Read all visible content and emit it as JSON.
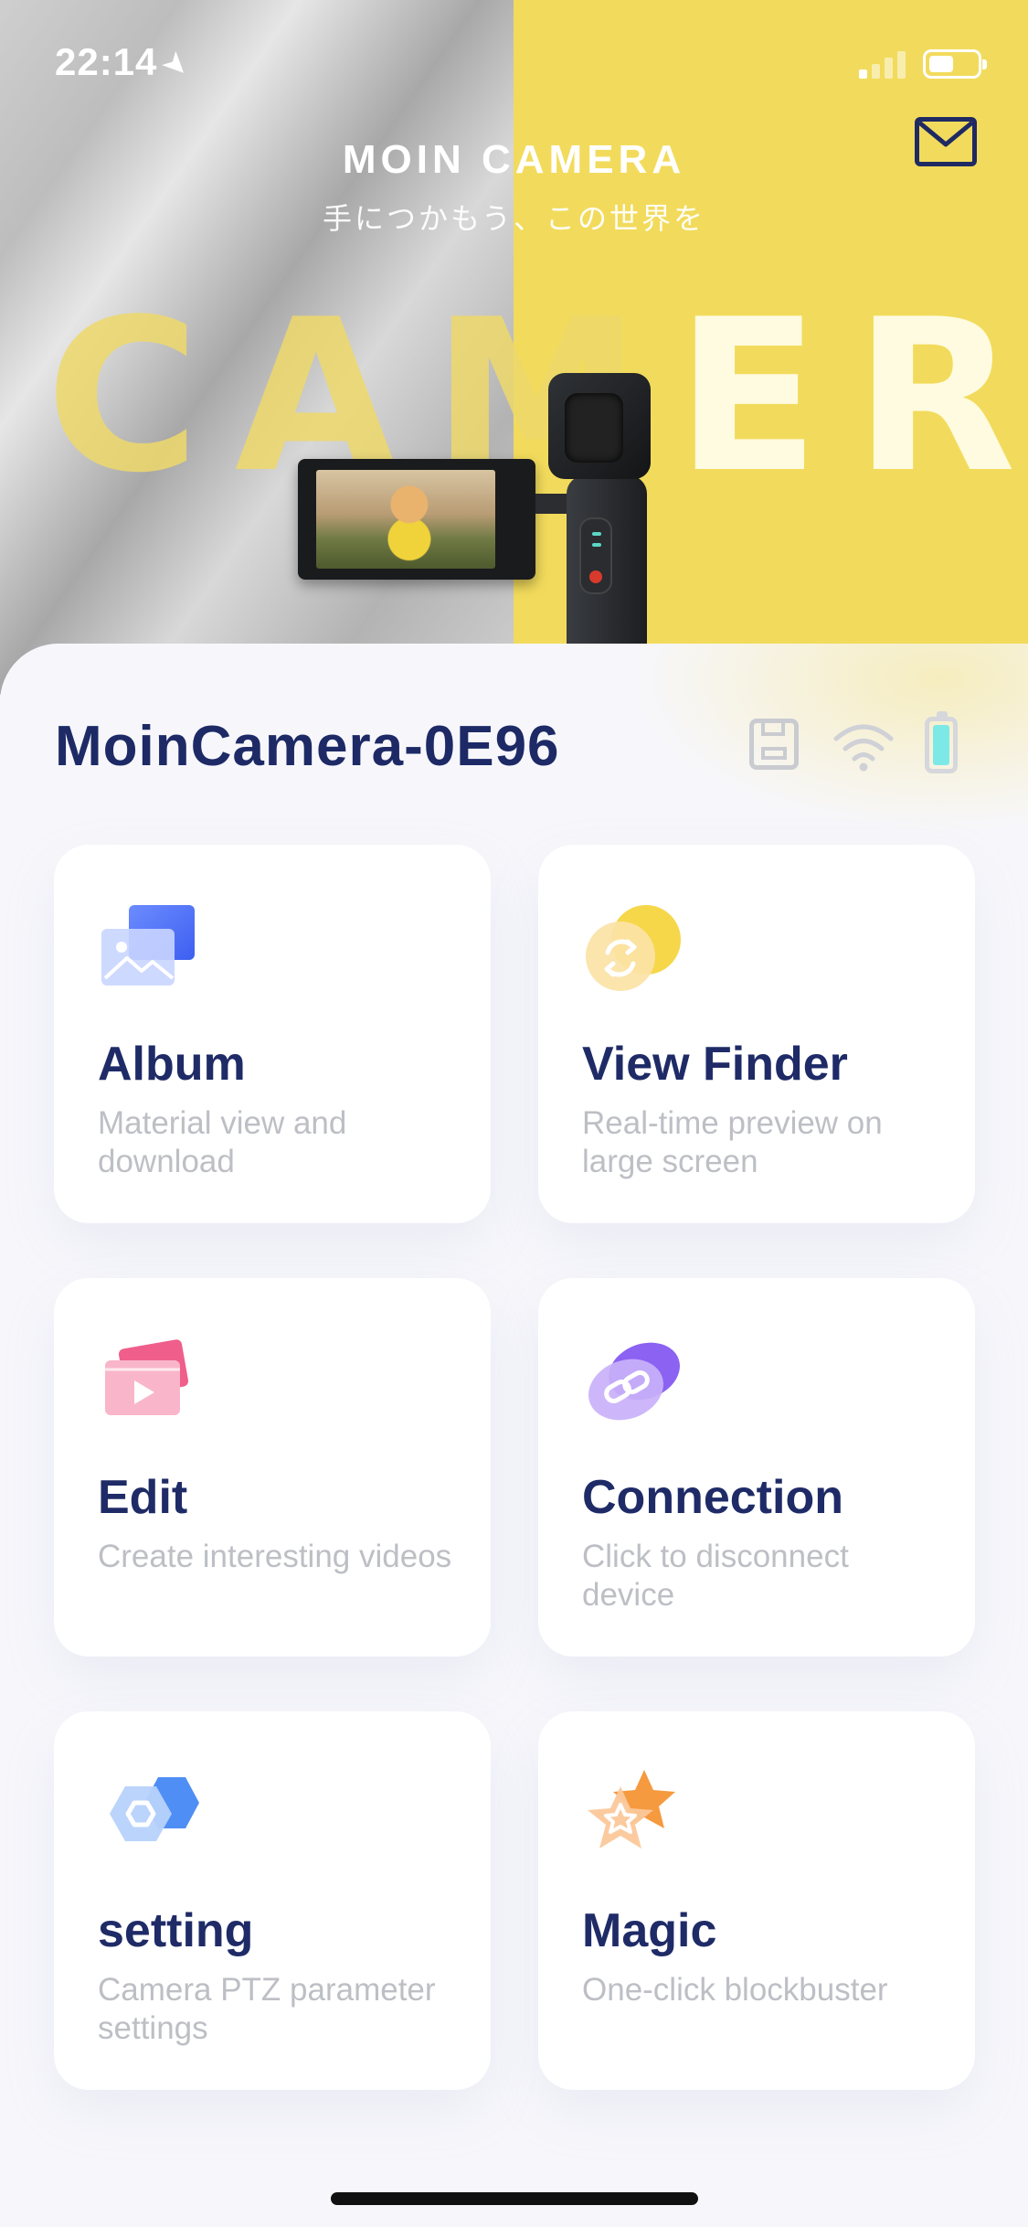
{
  "status_bar": {
    "time": "22:14",
    "location_glyph": "➤"
  },
  "header": {
    "brand_title": "MOIN CAMERA",
    "brand_subtitle": "手につかもう、この世界を",
    "big_word_left": "CAM",
    "big_word_right": "ERA",
    "mail_icon": "mail-icon"
  },
  "device": {
    "name": "MoinCamera-0E96",
    "status_icons": [
      "sd-card-icon",
      "wifi-icon",
      "battery-icon"
    ]
  },
  "cards": [
    {
      "title": "Album",
      "desc": "Material view and download",
      "icon": "album-icon"
    },
    {
      "title": "View Finder",
      "desc": "Real-time preview on large screen",
      "icon": "viewfinder-icon"
    },
    {
      "title": "Edit",
      "desc": "Create interesting videos",
      "icon": "edit-video-icon"
    },
    {
      "title": "Connection",
      "desc": "Click to disconnect device",
      "icon": "link-icon"
    },
    {
      "title": "setting",
      "desc": "Camera PTZ parameter settings",
      "icon": "hexagon-settings-icon"
    },
    {
      "title": "Magic",
      "desc": "One-click blockbuster",
      "icon": "star-magic-icon"
    }
  ],
  "colors": {
    "accent_navy": "#1d2a66",
    "hero_yellow": "#f2db5c",
    "battery_cyan": "#7de9e6"
  }
}
